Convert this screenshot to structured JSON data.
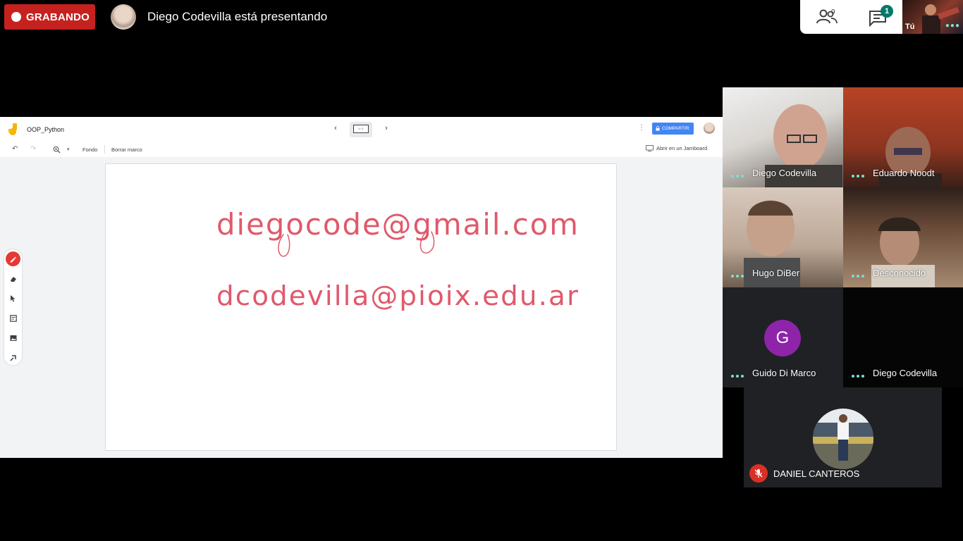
{
  "recording": {
    "label": "GRABANDO"
  },
  "presenter": {
    "text": "Diego Codevilla está presentando"
  },
  "top_controls": {
    "people_count": "9",
    "chat_badge": "1",
    "self_label": "Tú"
  },
  "jamboard": {
    "title": "OOP_Python",
    "share_label": "COMPARTIR",
    "frame_indicator": "1 / 1",
    "toolbar": {
      "background_label": "Fondo",
      "clear_frame_label": "Borrar marco",
      "open_in_jamboard_label": "Abrir en un Jamboard"
    },
    "handwriting": [
      "diegocode@gmail.com",
      "dcodevilla@pioix.edu.ar"
    ],
    "ink_color": "#e0596b",
    "accent_color": "#4285f4"
  },
  "participants": [
    {
      "name": "Diego Codevilla",
      "type": "video"
    },
    {
      "name": "Eduardo Noodt",
      "type": "video"
    },
    {
      "name": "Hugo DiBer",
      "type": "video"
    },
    {
      "name": "Desconocido",
      "type": "video"
    },
    {
      "name": "Guido Di Marco",
      "type": "avatar",
      "initial": "G",
      "avatar_color": "#8e24aa"
    },
    {
      "name": "Diego Codevilla",
      "type": "dark"
    }
  ],
  "muted_participant": {
    "name": "DANIEL CANTEROS"
  },
  "colors": {
    "recording_red": "#c5221f",
    "speaking_dots": "#7be0d0",
    "chat_badge": "#00796b",
    "mic_off_red": "#d93025"
  }
}
